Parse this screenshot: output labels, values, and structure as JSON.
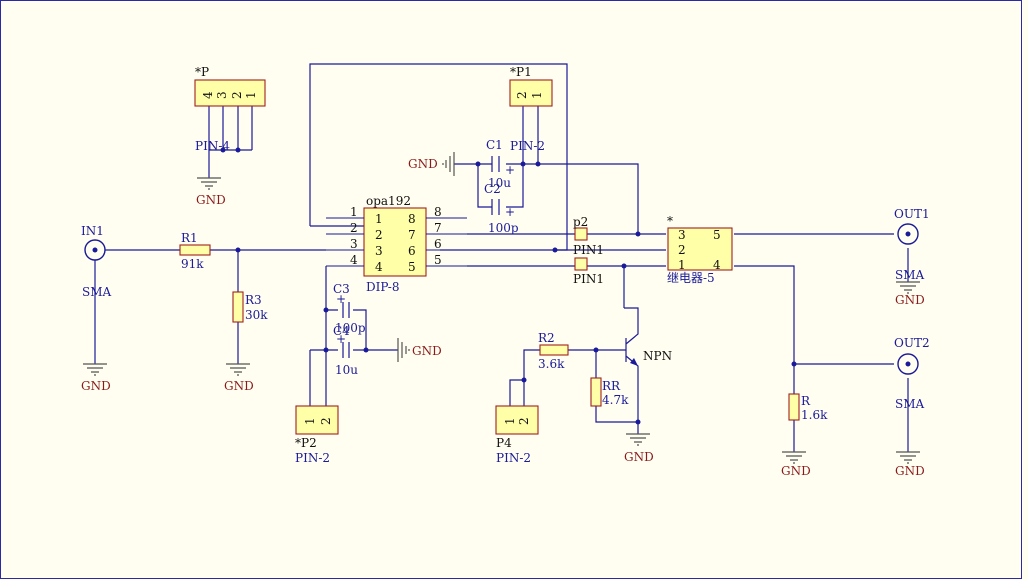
{
  "labels": {
    "in1_ref": "IN1",
    "in1_type": "SMA",
    "in1_gnd": "GND",
    "r1_ref": "R1",
    "r1_val": "91k",
    "r3_ref": "R3",
    "r3_val": "30k",
    "r3_gnd": "GND",
    "p_ref": "*P",
    "p_pin4": "4",
    "p_pin3": "3",
    "p_pin2": "2",
    "p_pin1": "1",
    "p_type": "PIN-4",
    "p_gnd": "GND",
    "p1_ref": "*P1",
    "p1_pin2": "2",
    "p1_pin1": "1",
    "p1_type": "PIN-2",
    "c1_ref": "C1",
    "c1_val": "10u",
    "c2_ref": "C2",
    "c2_val": "100p",
    "c_top_gnd": "GND",
    "u_ref": "opa192",
    "u_type": "DIP-8",
    "u_p1": "1",
    "u_p2": "2",
    "u_p3": "3",
    "u_p4": "4",
    "u_p5": "5",
    "u_p6": "6",
    "u_p7": "7",
    "u_p8": "8",
    "u_po8": "8",
    "u_po7": "7",
    "u_po6": "6",
    "u_po5": "5",
    "c3_ref": "C3",
    "c3_val": "100p",
    "c4_ref": "C4",
    "c4_val": "10u",
    "c_bot_gnd": "GND",
    "p2s_ref": "*P2",
    "p2s_pin1": "1",
    "p2s_pin2": "2",
    "p2s_type": "PIN-2",
    "p2_ref": "p2",
    "pin1a": "PIN1",
    "pin1b": "PIN1",
    "relay_ref": "*",
    "relay_type": "继电器-5",
    "relay_p3": "3",
    "relay_p2": "2",
    "relay_p1": "1",
    "relay_p5": "5",
    "relay_p4": "4",
    "r2_ref": "R2",
    "r2_val": "3.6k",
    "rr_ref": "RR",
    "rr_val": "4.7k",
    "npn": "NPN",
    "npn_gnd": "GND",
    "p4_ref": "P4",
    "p4_pin1": "1",
    "p4_pin2": "2",
    "p4_type": "PIN-2",
    "out1_ref": "OUT1",
    "out1_type": "SMA",
    "out1_gnd": "GND",
    "out2_ref": "OUT2",
    "out2_type": "SMA",
    "out2_gnd": "GND",
    "r_ref": "R",
    "r_val": "1.6k",
    "r_gnd": "GND"
  }
}
